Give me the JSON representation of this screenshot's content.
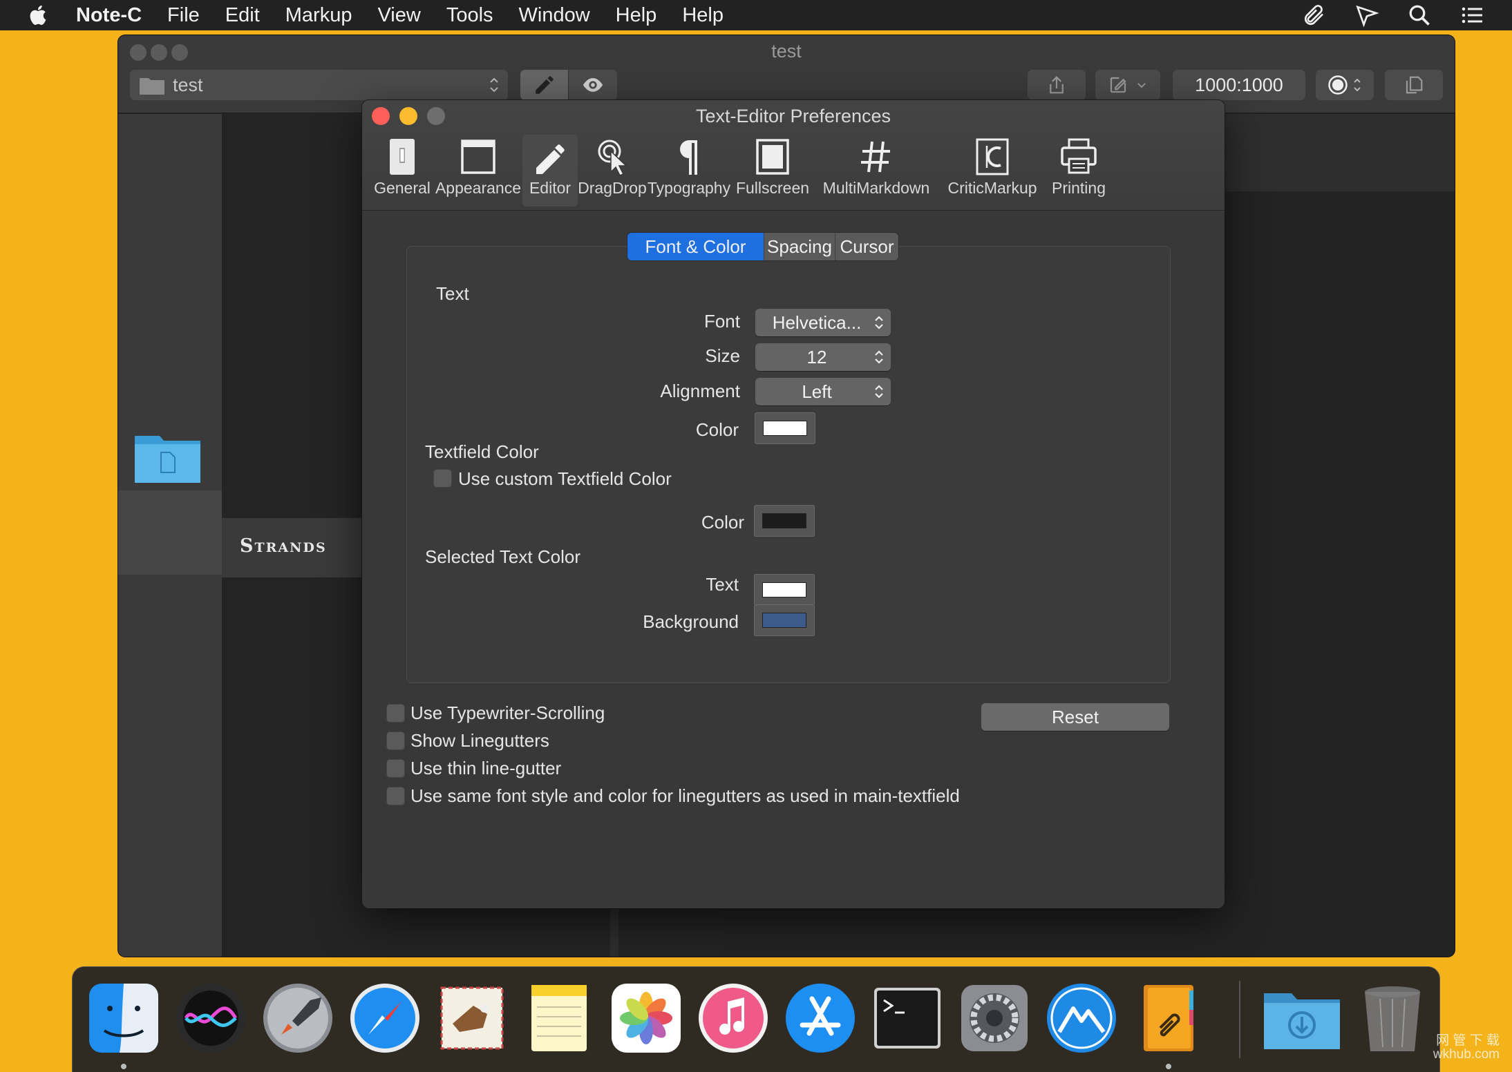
{
  "menubar": {
    "app_name": "Note-C",
    "items": [
      "File",
      "Edit",
      "Markup",
      "View",
      "Tools",
      "Window",
      "Help",
      "Help"
    ],
    "right_icons": [
      "paperclip-icon",
      "send-icon",
      "search-icon",
      "list-icon"
    ]
  },
  "doc_window": {
    "title": "test",
    "path_field": "test",
    "zoom_ratio": "1000:1000",
    "sidebar_label": "Strands"
  },
  "prefs": {
    "title": "Text-Editor Preferences",
    "toolbar": [
      {
        "label": "General",
        "icon": "general-icon"
      },
      {
        "label": "Appearance",
        "icon": "appearance-icon"
      },
      {
        "label": "Editor",
        "icon": "pencil-icon",
        "active": true
      },
      {
        "label": "DragDrop",
        "icon": "dragdrop-icon"
      },
      {
        "label": "Typography",
        "icon": "pilcrow-icon"
      },
      {
        "label": "Fullscreen",
        "icon": "fullscreen-icon"
      },
      {
        "label": "MultiMarkdown",
        "icon": "hash-icon"
      },
      {
        "label": "CriticMarkup",
        "icon": "criticmarkup-icon"
      },
      {
        "label": "Printing",
        "icon": "printer-icon"
      }
    ],
    "tabs": [
      "Font & Color",
      "Spacing",
      "Cursor"
    ],
    "active_tab": "Font & Color",
    "text_section": {
      "heading": "Text",
      "font_label": "Font",
      "font_value": "Helvetica...",
      "size_label": "Size",
      "size_value": "12",
      "alignment_label": "Alignment",
      "alignment_value": "Left",
      "color_label": "Color",
      "color_value": "#ffffff"
    },
    "textfield_section": {
      "heading": "Textfield Color",
      "checkbox_label": "Use custom Textfield Color",
      "checked": false,
      "color_label": "Color",
      "color_value": "#1c1c1c"
    },
    "selected_section": {
      "heading": "Selected Text Color",
      "text_label": "Text",
      "text_color": "#ffffff",
      "background_label": "Background",
      "background_color": "#3d5a8c"
    },
    "options": [
      {
        "label": "Use Typewriter-Scrolling",
        "checked": false
      },
      {
        "label": "Show Linegutters",
        "checked": false
      },
      {
        "label": "Use thin line-gutter",
        "checked": false
      },
      {
        "label": "Use same font style and color for linegutters as used in main-textfield",
        "checked": false
      }
    ],
    "reset_label": "Reset"
  },
  "dock": {
    "apps": [
      "Finder",
      "Siri",
      "Launchpad",
      "Safari",
      "Mail",
      "Notes",
      "Photos",
      "iTunes",
      "App Store",
      "Terminal",
      "System Preferences",
      "Bootcamp",
      "Note-C",
      "Downloads",
      "Trash"
    ]
  },
  "watermark": {
    "line1": "网 管 下 载",
    "line2": "wkhub.com"
  },
  "colors": {
    "accent": "#1e70e0",
    "desktop": "#f5b31b",
    "close": "#fc5f57",
    "minimize": "#fdbc2e",
    "zoom_inactive": "#6e6e6e"
  }
}
